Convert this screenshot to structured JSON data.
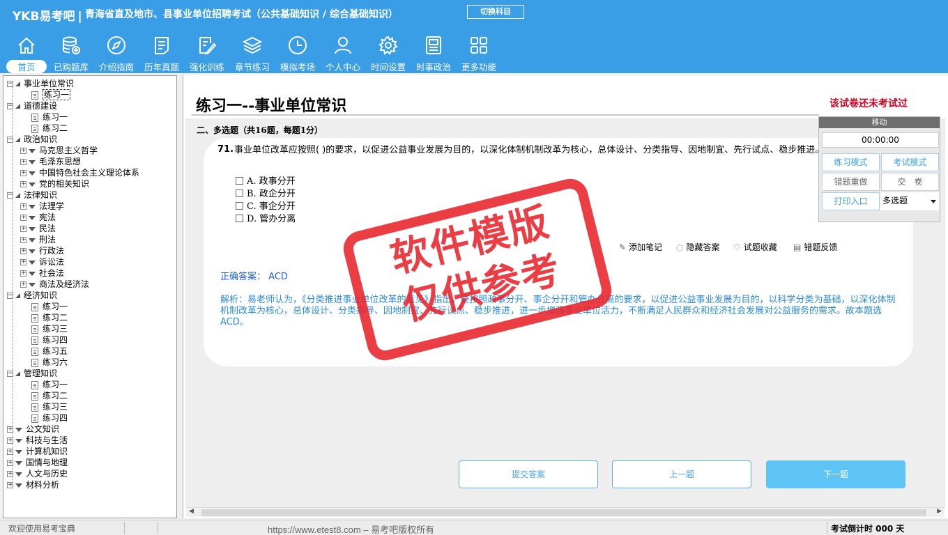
{
  "header": {
    "brand_logo": "YKB易考吧",
    "brand_sep": "|",
    "exam_title": "青海省直及地市、县事业单位招聘考试（公共基础知识 / 综合基础知识）",
    "switch_label": "切换科目",
    "bg_color": "#3a9ee6"
  },
  "nav": [
    {
      "label": "首页",
      "icon": "home-icon",
      "active": true
    },
    {
      "label": "已购题库",
      "icon": "database-icon"
    },
    {
      "label": "介绍指南",
      "icon": "compass-icon"
    },
    {
      "label": "历年真题",
      "icon": "list-doc-icon"
    },
    {
      "label": "强化训练",
      "icon": "edit-icon"
    },
    {
      "label": "章节练习",
      "icon": "layers-icon"
    },
    {
      "label": "模拟考场",
      "icon": "clock-icon"
    },
    {
      "label": "个人中心",
      "icon": "user-icon"
    },
    {
      "label": "时间设置",
      "icon": "gear-icon"
    },
    {
      "label": "时事政治",
      "icon": "newspaper-icon"
    },
    {
      "label": "更多功能",
      "icon": "grid-icon"
    }
  ],
  "tree": [
    {
      "label": "事业单位常识",
      "level": 0,
      "open": true
    },
    {
      "label": "练习一",
      "level": 1,
      "selected": true
    },
    {
      "label": "道德建设",
      "level": 0,
      "open": true
    },
    {
      "label": "练习一",
      "level": 1
    },
    {
      "label": "练习二",
      "level": 1
    },
    {
      "label": "政治知识",
      "level": 0,
      "open": true
    },
    {
      "label": "马克思主义哲学",
      "level": 1,
      "folder": true
    },
    {
      "label": "毛泽东思想",
      "level": 1,
      "folder": true
    },
    {
      "label": "中国特色社会主义理论体系",
      "level": 1,
      "folder": true
    },
    {
      "label": "党的相关知识",
      "level": 1,
      "folder": true
    },
    {
      "label": "法律知识",
      "level": 0,
      "open": true
    },
    {
      "label": "法理学",
      "level": 1,
      "folder": true
    },
    {
      "label": "宪法",
      "level": 1,
      "folder": true
    },
    {
      "label": "民法",
      "level": 1,
      "folder": true
    },
    {
      "label": "刑法",
      "level": 1,
      "folder": true
    },
    {
      "label": "行政法",
      "level": 1,
      "folder": true
    },
    {
      "label": "诉讼法",
      "level": 1,
      "folder": true
    },
    {
      "label": "社会法",
      "level": 1,
      "folder": true
    },
    {
      "label": "商法及经济法",
      "level": 1,
      "folder": true
    },
    {
      "label": "经济知识",
      "level": 0,
      "open": true
    },
    {
      "label": "练习一",
      "level": 1
    },
    {
      "label": "练习二",
      "level": 1
    },
    {
      "label": "练习三",
      "level": 1
    },
    {
      "label": "练习四",
      "level": 1
    },
    {
      "label": "练习五",
      "level": 1
    },
    {
      "label": "练习六",
      "level": 1
    },
    {
      "label": "管理知识",
      "level": 0,
      "open": true
    },
    {
      "label": "练习一",
      "level": 1
    },
    {
      "label": "练习二",
      "level": 1
    },
    {
      "label": "练习三",
      "level": 1
    },
    {
      "label": "练习四",
      "level": 1
    },
    {
      "label": "公文知识",
      "level": 0
    },
    {
      "label": "科技与生活",
      "level": 0
    },
    {
      "label": "计算机知识",
      "level": 0
    },
    {
      "label": "国情与地理",
      "level": 0
    },
    {
      "label": "人文与历史",
      "level": 0
    },
    {
      "label": "材料分析",
      "level": 0
    }
  ],
  "main": {
    "page_title": "练习一--事业单位常识",
    "status_note": "该试卷还未考试过",
    "section_head": "二、多选题（共16题，每题1分）",
    "question": {
      "number": "71.",
      "text": "事业单位改革应按照(  )的要求，以促进公益事业发展为目的，以深化体制机制改革为核心，总体设计、分类指导、因地制宜、先行试点、稳步推进。",
      "options": [
        "A. 政事分开",
        "B. 政企分开",
        "C. 事企分开",
        "D. 管办分离"
      ]
    },
    "tools": {
      "add_note": "添加笔记",
      "hide_answer": "隐藏答案",
      "favorite": "试题收藏",
      "feedback": "错题反馈"
    },
    "answer_label": "正确答案：",
    "answer_value": "ACD",
    "analysis": "解析：易老师认为，《分类推进事业单位改革的意见》指出，要按照政事分开、事企分开和管办分离的要求，以促进公益事业发展为目的，以科学分类为基础，以深化体制机制改革为核心，总体设计、分类指导、因地制宜、先行试点、稳步推进，进一步增强事业单位活力，不断满足人民群众和经济社会发展对公益服务的需求。故本题选ACD。",
    "buttons": {
      "submit": "提交答案",
      "prev": "上一题",
      "next": "下一题"
    }
  },
  "panel": {
    "title": "移动",
    "timer": "00:00:00",
    "practice_mode": "练习模式",
    "exam_mode": "考试模式",
    "wrong_redo": "错题重做",
    "submit_paper": "交　卷",
    "print": "打印入口",
    "type_select": "多选题"
  },
  "watermark": {
    "line1": "软件模版",
    "line2": "仅供参考"
  },
  "status": {
    "welcome": "欢迎使用易考宝典",
    "url": "https://www.etest8.com – 易考吧版权所有",
    "countdown": "考试倒计时 000 天"
  }
}
